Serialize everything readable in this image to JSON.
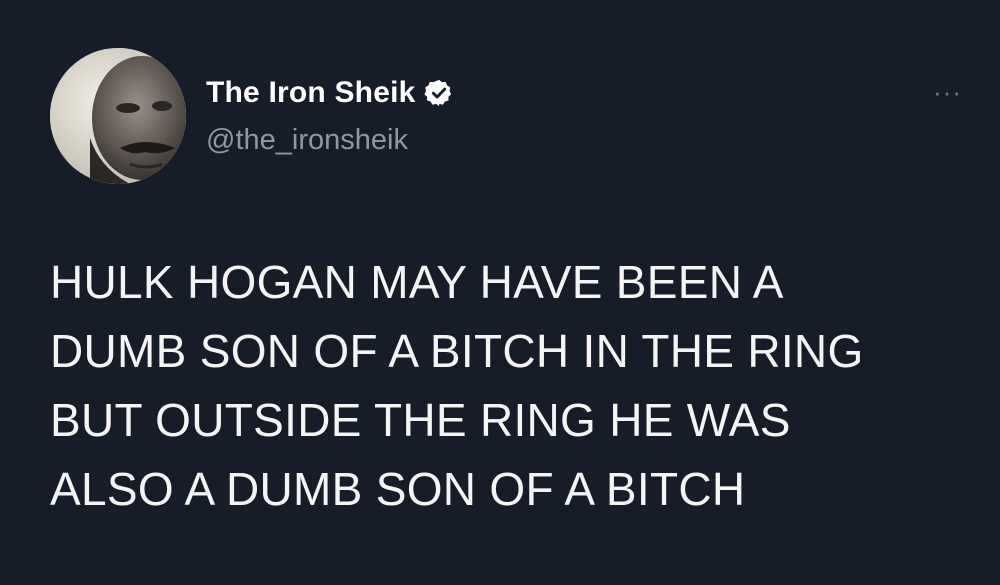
{
  "tweet": {
    "author": {
      "display_name": "The Iron Sheik",
      "handle": "@the_ironsheik",
      "verified": true
    },
    "more_label": "···",
    "body_lines": [
      "HULK HOGAN MAY HAVE BEEN A",
      "DUMB SON OF A BITCH IN THE RING",
      "BUT OUTSIDE THE RING HE WAS",
      "ALSO A DUMB SON OF A BITCH"
    ]
  },
  "colors": {
    "background": "#161d29",
    "text": "#f4f4f4",
    "secondary_text": "#8b98a5",
    "verified_badge": "#ffffff"
  },
  "icons": {
    "verified": "verified-badge-icon",
    "more": "more-options-icon"
  }
}
